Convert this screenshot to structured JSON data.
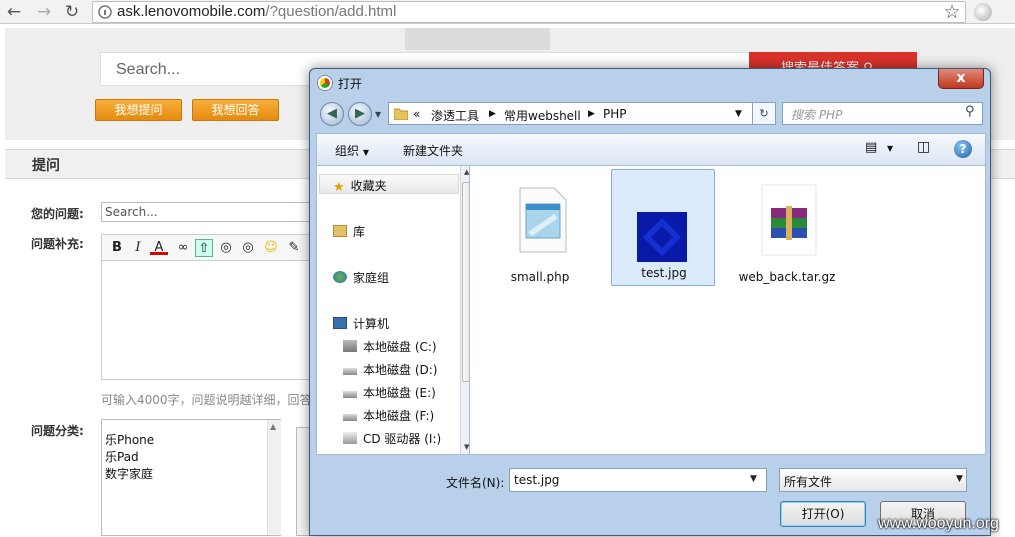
{
  "browser": {
    "back_icon": "←",
    "forward_icon": "→",
    "reload_icon": "↻",
    "url_host": "ask.lenovomobile.com",
    "url_path": "/?question/add.html",
    "star_icon": "☆"
  },
  "page": {
    "search_placeholder": "Search...",
    "search_button": "搜索最佳答案",
    "ask_button": "我想提问",
    "answer_button": "我想回答",
    "section_title": "提问",
    "question_label": "您的问题:",
    "question_placeholder": "Search...",
    "supplement_label": "问题补充:",
    "hint": "可输入4000字，问题说明越详细，回答",
    "category_label": "问题分类:",
    "categories": [
      "乐Phone",
      "乐Pad",
      "数字家庭"
    ],
    "toolbar": {
      "bold": "B",
      "italic": "I",
      "color": "A"
    }
  },
  "dialog": {
    "title": "打开",
    "close": "x",
    "breadcrumb": {
      "root": "«",
      "items": [
        "渗透工具",
        "常用webshell",
        "PHP"
      ]
    },
    "search_placeholder": "搜索 PHP",
    "organize": "组织",
    "new_folder": "新建文件夹",
    "nav": {
      "favorites": "收藏夹",
      "library": "库",
      "homegroup": "家庭组",
      "computer": "计算机",
      "drives": [
        "本地磁盘 (C:)",
        "本地磁盘 (D:)",
        "本地磁盘 (E:)",
        "本地磁盘 (F:)",
        "CD 驱动器 (I:)"
      ]
    },
    "files": [
      {
        "name": "small.php"
      },
      {
        "name": "test.jpg"
      },
      {
        "name": "web_back.tar.gz"
      }
    ],
    "filename_label": "文件名(N):",
    "filename_value": "test.jpg",
    "filetype_value": "所有文件",
    "open_button": "打开(O)",
    "cancel_button": "取消"
  },
  "watermark": "www.wooyun.org"
}
